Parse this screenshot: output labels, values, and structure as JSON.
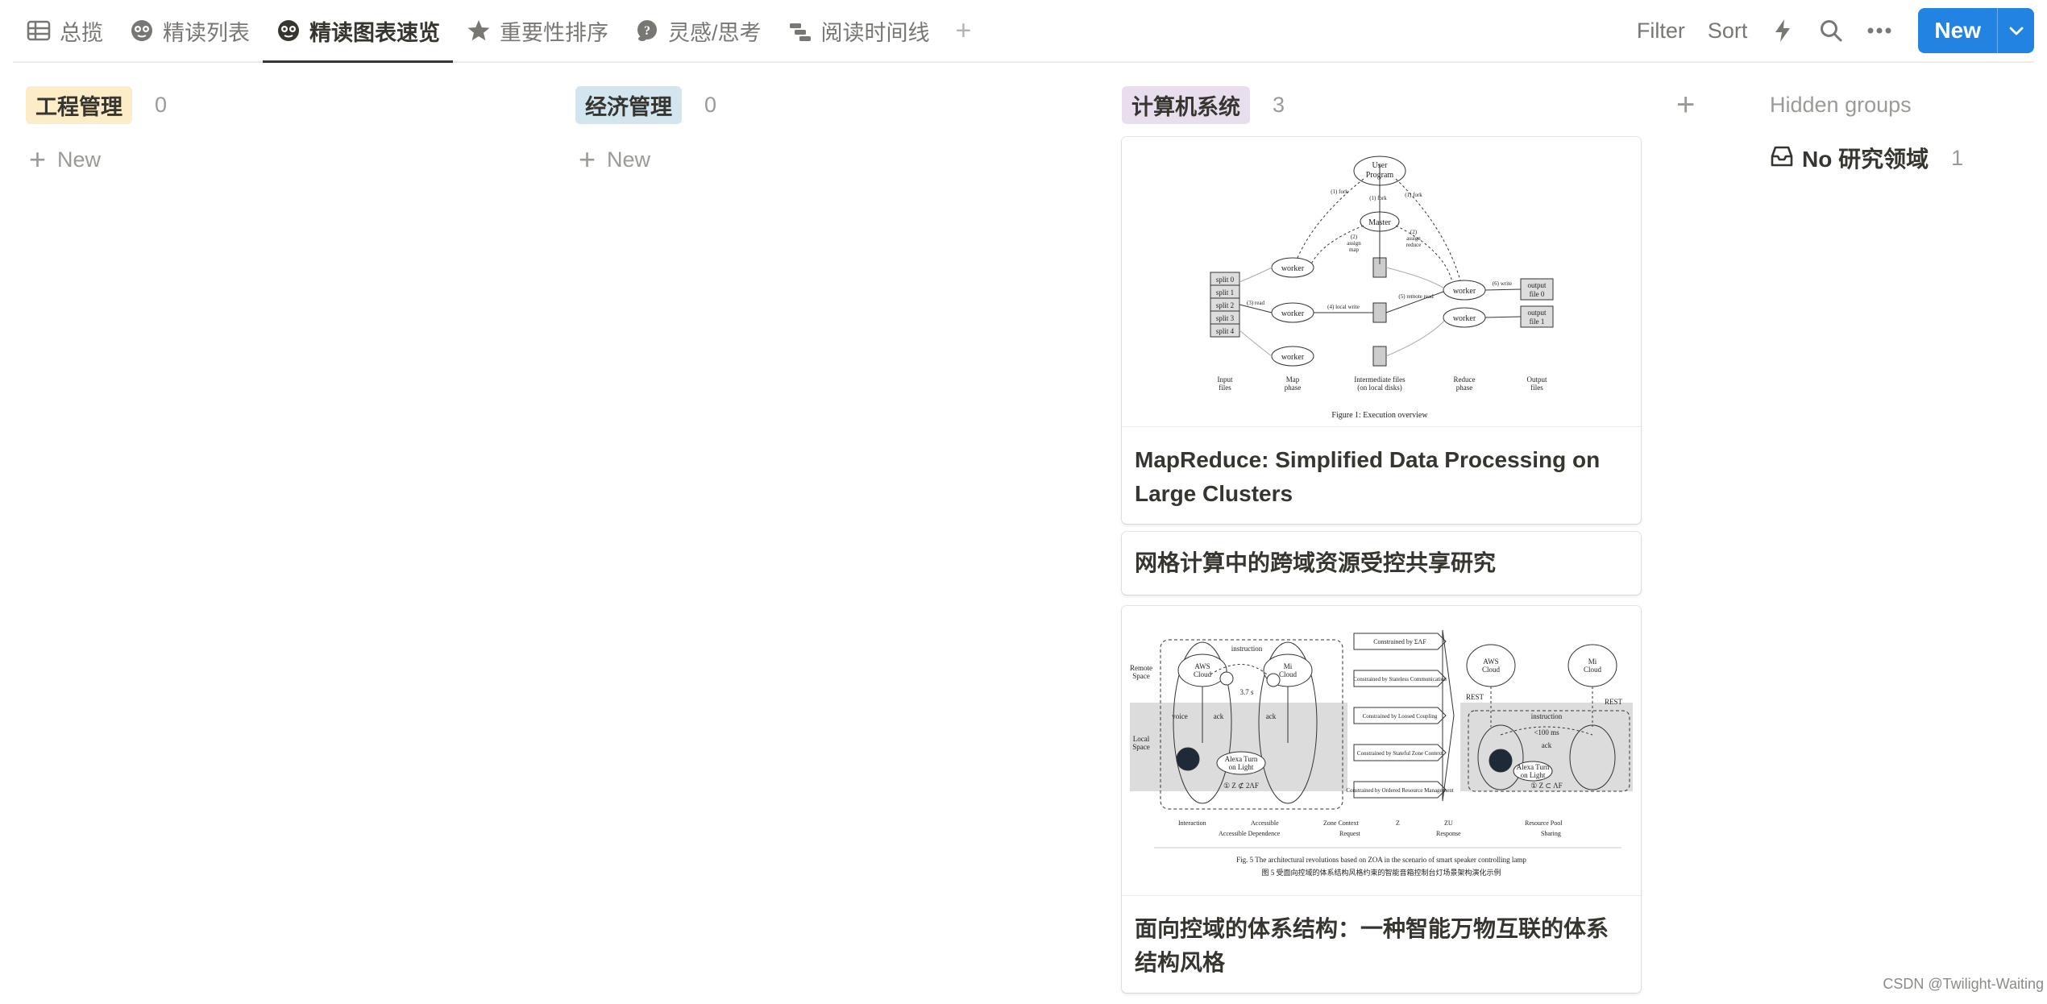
{
  "tabs": [
    {
      "label": "总揽",
      "icon": "table-icon",
      "active": false
    },
    {
      "label": "精读列表",
      "icon": "nerd-face-icon",
      "active": false
    },
    {
      "label": "精读图表速览",
      "icon": "nerd-face-icon",
      "active": true
    },
    {
      "label": "重要性排序",
      "icon": "star-icon",
      "active": false
    },
    {
      "label": "灵感/思考",
      "icon": "thinking-face-icon",
      "active": false
    },
    {
      "label": "阅读时间线",
      "icon": "timeline-icon",
      "active": false
    }
  ],
  "toolbar": {
    "filter_label": "Filter",
    "sort_label": "Sort",
    "automation_icon": "lightning-icon",
    "search_icon": "search-icon",
    "more_icon": "more-icon",
    "new_label": "New"
  },
  "columns": [
    {
      "name": "工程管理",
      "count": "0",
      "color": "#fdecc8",
      "new_label": "New"
    },
    {
      "name": "经济管理",
      "count": "0",
      "color": "#d3e5ef",
      "new_label": "New"
    },
    {
      "name": "计算机系统",
      "count": "3",
      "color": "#e8deee"
    }
  ],
  "cards": [
    {
      "title": "MapReduce: Simplified Data Processing on Large Clusters",
      "cover": {
        "caption": "Figure 1: Execution overview",
        "user_program": [
          "User",
          "Program"
        ],
        "master": "Master",
        "worker": "worker",
        "splits": [
          "split 0",
          "split 1",
          "split 2",
          "split 3",
          "split 4"
        ],
        "outputs": [
          [
            "output",
            "file 0"
          ],
          [
            "output",
            "file 1"
          ]
        ],
        "edge_fork": "(1) fork",
        "edge_assign_map": [
          "(2)",
          "assign",
          "map"
        ],
        "edge_assign_reduce": [
          "(2)",
          "assign",
          "reduce"
        ],
        "edge_read": "(3) read",
        "edge_local_write": "(4) local write",
        "edge_remote_read": "(5) remote read",
        "edge_write": "(6) write",
        "phase_labels": [
          [
            "Input",
            "files"
          ],
          [
            "Map",
            "phase"
          ],
          [
            "Intermediate files",
            "(on local disks)"
          ],
          [
            "Reduce",
            "phase"
          ],
          [
            "Output",
            "files"
          ]
        ]
      }
    },
    {
      "title": "网格计算中的跨域资源受控共享研究"
    },
    {
      "title": "面向控域的体系结构：一种智能万物互联的体系结构风格",
      "cover": {
        "remote_space": [
          "Remote",
          "Space"
        ],
        "local_space": [
          "Local",
          "Space"
        ],
        "aws_cloud": [
          "AWS",
          "Cloud"
        ],
        "mi_cloud": [
          "Mi",
          "Cloud"
        ],
        "instruction": "instruction",
        "latency_left": "3.7 s",
        "latency_right": "<100 ms",
        "ack": "ack",
        "voice": "voice",
        "alexa": [
          "Alexa Turn",
          "on Light"
        ],
        "zone_left": "① Z ⊄ 2ΛF",
        "zone_right": "① Z ⊂ ΛF",
        "rest": "REST",
        "steps": [
          "Constrained by ΣΛF",
          "Constrained by Stateless Communication",
          "Constrained by Loosed Coupling",
          "Constrained by Stateful Zone Context",
          "Constrained by Ordered Resource Management"
        ],
        "legend_row1": [
          "Interaction",
          "Accessible",
          "Zone Context",
          "Z",
          "ZU",
          "Resource Pool"
        ],
        "legend_row2": [
          "Accessible Dependence",
          "Request",
          "Response",
          "Sharing"
        ],
        "caption_en": "Fig. 5   The architectural revolutions based on ZOA in the scenario of smart speaker controlling lamp",
        "caption_cn": "图 5   受面向控域的体系结构风格约束的智能音箱控制台灯场景架构演化示例"
      }
    }
  ],
  "hidden_groups": {
    "title": "Hidden groups",
    "items": [
      {
        "label": "No 研究领域",
        "count": "1",
        "icon": "inbox-icon"
      }
    ]
  },
  "watermark": "CSDN @Twilight-Waiting"
}
